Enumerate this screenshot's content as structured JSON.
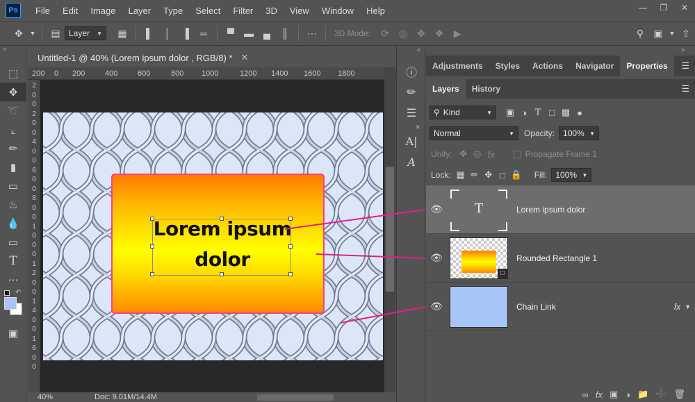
{
  "app": {
    "logo": "Ps"
  },
  "menu": [
    "File",
    "Edit",
    "Image",
    "Layer",
    "Type",
    "Select",
    "Filter",
    "3D",
    "View",
    "Window",
    "Help"
  ],
  "options_bar": {
    "layer_select": "Layer",
    "mode_label": "3D Mode:"
  },
  "document": {
    "tab_title": "Untitled-1 @ 40% (Lorem ipsum dolor , RGB/8) *",
    "ruler_top": [
      "200",
      "0",
      "200",
      "400",
      "600",
      "800",
      "1000",
      "1200",
      "1400",
      "1600",
      "1800"
    ],
    "ruler_left": [
      "2",
      "0",
      "0",
      "2",
      "0",
      "0",
      "4",
      "0",
      "0",
      "6",
      "0",
      "0",
      "8",
      "0",
      "0",
      "1",
      "0",
      "0",
      "0",
      "1",
      "2",
      "0",
      "0",
      "1",
      "4",
      "0",
      "0",
      "1",
      "6",
      "0",
      "0"
    ],
    "canvas_text_line1": "Lorem ipsum",
    "canvas_text_line2": "dolor",
    "zoom": "40%",
    "doc_size": "Doc: 9.01M/14.4M"
  },
  "panels": {
    "tabs_top": [
      "Adjustments",
      "Styles",
      "Actions",
      "Navigator",
      "Properties"
    ],
    "tabs_layers": [
      "Layers",
      "History"
    ],
    "filter_kind": "Kind",
    "blend_mode": "Normal",
    "opacity_label": "Opacity:",
    "opacity_value": "100%",
    "unify_label": "Unify:",
    "propagate_label": "Propagate Frame 1",
    "lock_label": "Lock:",
    "fill_label": "Fill:",
    "fill_value": "100%"
  },
  "layers": [
    {
      "name": "Lorem ipsum dolor",
      "thumb_glyph": "T"
    },
    {
      "name": "Rounded Rectangle 1"
    },
    {
      "name": "Chain Link",
      "fx": "fx"
    }
  ],
  "colors": {
    "accent_line": "#e0208a",
    "rect_border": "#ff3b8a",
    "artboard": "#dbe6f8",
    "chain_thumb": "#a7c5f5"
  }
}
